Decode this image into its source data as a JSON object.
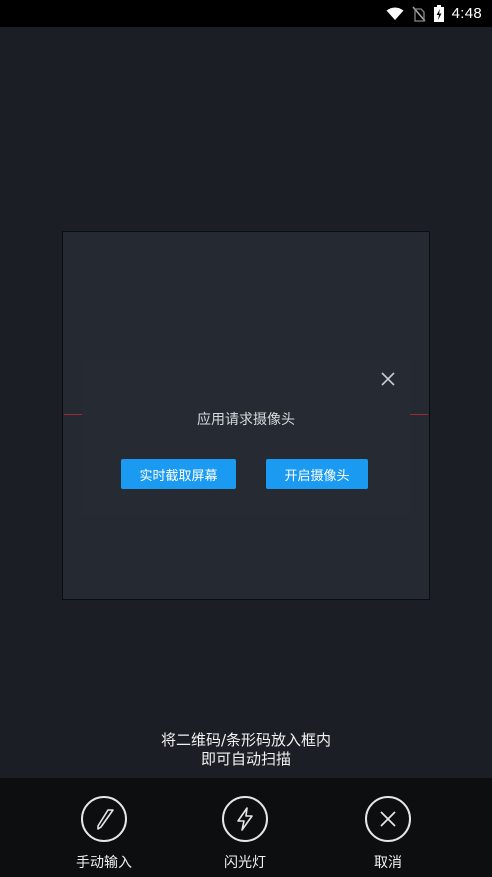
{
  "status_bar": {
    "time": "4:48",
    "icons": [
      "wifi-icon",
      "no-sim-icon",
      "battery-charging-icon"
    ]
  },
  "dialog": {
    "title": "应用请求摄像头",
    "screen_capture_label": "实时截取屏幕",
    "open_camera_label": "开启摄像头",
    "close_icon": "close-icon"
  },
  "hint": {
    "line1": "将二维码/条形码放入框内",
    "line2": "即可自动扫描"
  },
  "actions": {
    "manual_input": {
      "label": "手动输入",
      "icon": "pen-icon"
    },
    "flashlight": {
      "label": "闪光灯",
      "icon": "flash-icon"
    },
    "cancel": {
      "label": "取消",
      "icon": "close-circle-icon"
    }
  },
  "colors": {
    "accent": "#1a9af0",
    "background": "#1b1f25",
    "bottom_bar": "#0d0e10",
    "scan_line": "#9a2a35"
  }
}
